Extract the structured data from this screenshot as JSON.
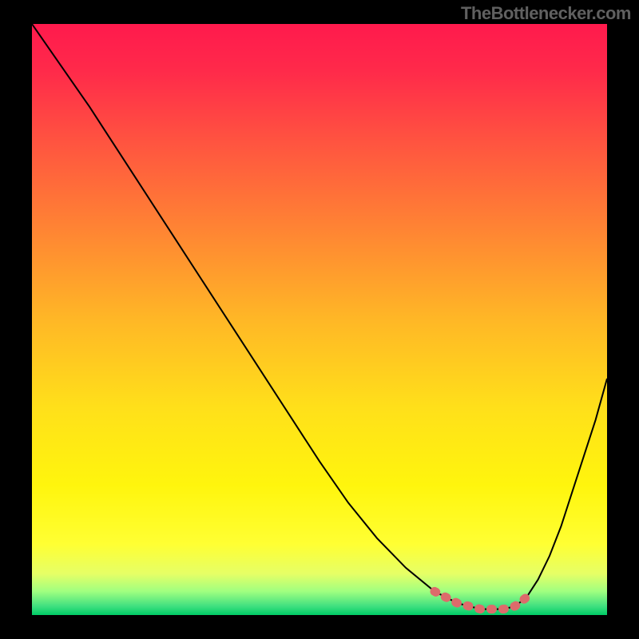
{
  "watermark": "TheBottlenecker.com",
  "chart_data": {
    "type": "line",
    "title": "",
    "xlabel": "",
    "ylabel": "",
    "xlim": [
      0,
      100
    ],
    "ylim": [
      0,
      100
    ],
    "series": [
      {
        "name": "curve",
        "x": [
          0,
          5,
          10,
          15,
          20,
          25,
          30,
          35,
          40,
          45,
          50,
          55,
          60,
          65,
          70,
          72,
          74,
          76,
          78,
          80,
          82,
          84,
          86,
          88,
          90,
          92,
          94,
          96,
          98,
          100
        ],
        "y": [
          100,
          93,
          86,
          78.5,
          71,
          63.5,
          56,
          48.5,
          41,
          33.5,
          26,
          19,
          13,
          8,
          4,
          3,
          2,
          1.5,
          1,
          1,
          1,
          1.5,
          3,
          6,
          10,
          15,
          21,
          27,
          33,
          40
        ]
      },
      {
        "name": "optimal-band",
        "x": [
          70,
          72,
          74,
          76,
          78,
          80,
          82,
          84,
          86
        ],
        "y": [
          4,
          3,
          2,
          1.5,
          1,
          1,
          1,
          1.5,
          3
        ]
      }
    ],
    "gradient_stops": [
      {
        "offset": 0.0,
        "color": "#ff1a4d"
      },
      {
        "offset": 0.08,
        "color": "#ff2a4a"
      },
      {
        "offset": 0.2,
        "color": "#ff5440"
      },
      {
        "offset": 0.35,
        "color": "#ff8533"
      },
      {
        "offset": 0.5,
        "color": "#ffb726"
      },
      {
        "offset": 0.65,
        "color": "#ffe01a"
      },
      {
        "offset": 0.78,
        "color": "#fff50d"
      },
      {
        "offset": 0.88,
        "color": "#ffff33"
      },
      {
        "offset": 0.93,
        "color": "#e6ff66"
      },
      {
        "offset": 0.96,
        "color": "#a0ff80"
      },
      {
        "offset": 0.985,
        "color": "#40e080"
      },
      {
        "offset": 1.0,
        "color": "#00cc66"
      }
    ],
    "optimal_marker_color": "#dd6b6b",
    "curve_color": "#000000"
  }
}
